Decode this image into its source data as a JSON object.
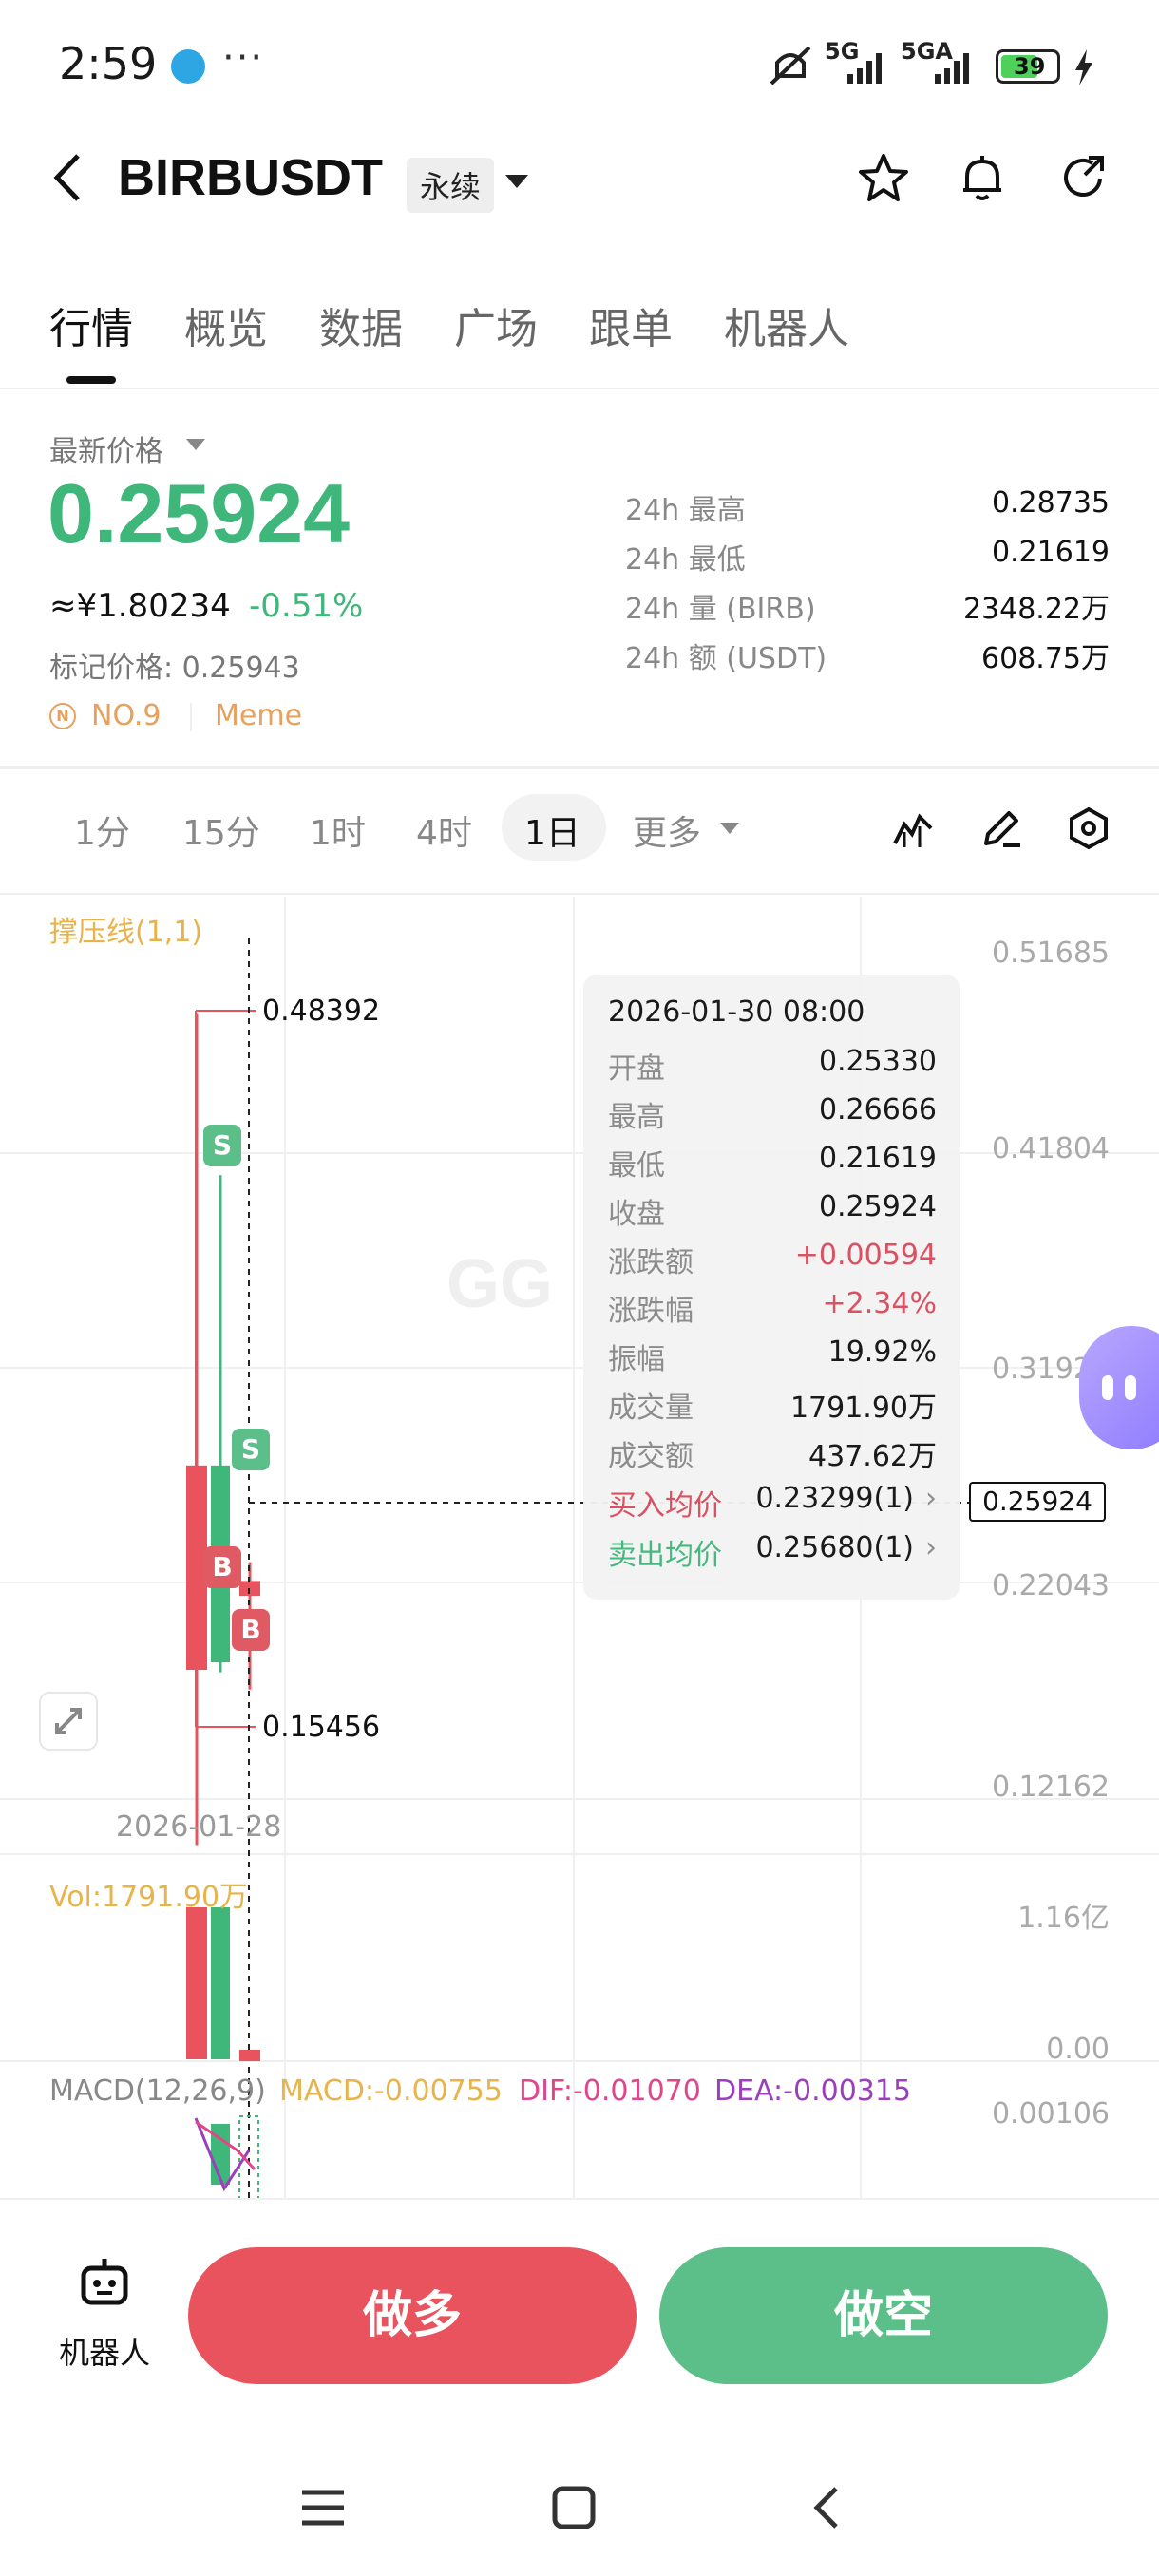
{
  "status_bar": {
    "time": "2:59",
    "more": "···",
    "net1": "5G",
    "net2": "5GA",
    "battery": "39"
  },
  "header": {
    "symbol": "BIRBUSDT",
    "contract_type": "永续"
  },
  "tabs": [
    "行情",
    "概览",
    "数据",
    "广场",
    "跟单",
    "机器人"
  ],
  "ticker": {
    "latest_label": "最新价格",
    "last_price": "0.25924",
    "cny_price": "≈¥1.80234",
    "change_pct": "-0.51%",
    "mark_price": "标记价格: 0.25943",
    "rank": "NO.9",
    "tag": "Meme",
    "stats": [
      {
        "label": "24h  最高",
        "value": "0.28735"
      },
      {
        "label": "24h  最低",
        "value": "0.21619"
      },
      {
        "label": "24h  量 (BIRB)",
        "value": "2348.22万"
      },
      {
        "label": "24h  额 (USDT)",
        "value": "608.75万"
      }
    ]
  },
  "timeframes": [
    "1分",
    "15分",
    "1时",
    "4时",
    "1日",
    "更多"
  ],
  "active_timeframe": "1日",
  "chart": {
    "indicator_label": "撑压线(1,1)",
    "y_axis": [
      "0.51685",
      "0.41804",
      "0.31924",
      "0.22043",
      "0.12162"
    ],
    "high_label": "0.48392",
    "low_label": "0.15456",
    "current_price_tag": "0.25924",
    "date_label": "2026-01-28",
    "volume_label": "Vol:1791.90万",
    "vol_axis": [
      "1.16亿",
      "0.00"
    ],
    "macd_label": "MACD(12,26,9)",
    "macd_value": "MACD:-0.00755",
    "dif_value": "DIF:-0.01070",
    "dea_value": "DEA:-0.00315",
    "macd_axis": "0.00106",
    "watermark": "GG"
  },
  "tooltip": {
    "date": "2026-01-30 08:00",
    "rows": [
      {
        "k": "开盘",
        "v": "0.25330"
      },
      {
        "k": "最高",
        "v": "0.26666"
      },
      {
        "k": "最低",
        "v": "0.21619"
      },
      {
        "k": "收盘",
        "v": "0.25924"
      },
      {
        "k": "涨跌额",
        "v": "+0.00594"
      },
      {
        "k": "涨跌幅",
        "v": "+2.34%"
      },
      {
        "k": "振幅",
        "v": "19.92%"
      },
      {
        "k": "成交量",
        "v": "1791.90万"
      },
      {
        "k": "成交额",
        "v": "437.62万"
      }
    ],
    "buy_avg_label": "买入均价",
    "buy_avg_value": "0.23299(1)",
    "sell_avg_label": "卖出均价",
    "sell_avg_value": "0.25680(1)"
  },
  "bottom": {
    "robot_label": "机器人",
    "long_label": "做多",
    "short_label": "做空"
  },
  "markers": {
    "buy": "B",
    "sell": "S"
  },
  "chart_data": {
    "type": "candlestick",
    "date_label": "2026-01-28",
    "candles": [
      {
        "open": 0.305,
        "high": 0.48392,
        "low": 0.15456,
        "close": 0.224,
        "color": "red"
      },
      {
        "open": 0.227,
        "high": 0.42,
        "low": 0.223,
        "close": 0.305,
        "color": "green"
      },
      {
        "open": 0.2533,
        "high": 0.26666,
        "low": 0.21619,
        "close": 0.25924,
        "color": "red"
      }
    ],
    "volume": {
      "label": "Vol:1791.90万",
      "axis": [
        "1.16亿",
        "0.00"
      ]
    },
    "ylim": [
      0.12162,
      0.51685
    ]
  },
  "colors": {
    "up": "#3fb67a",
    "down": "#e8535e",
    "accent": "#e8a05e"
  }
}
